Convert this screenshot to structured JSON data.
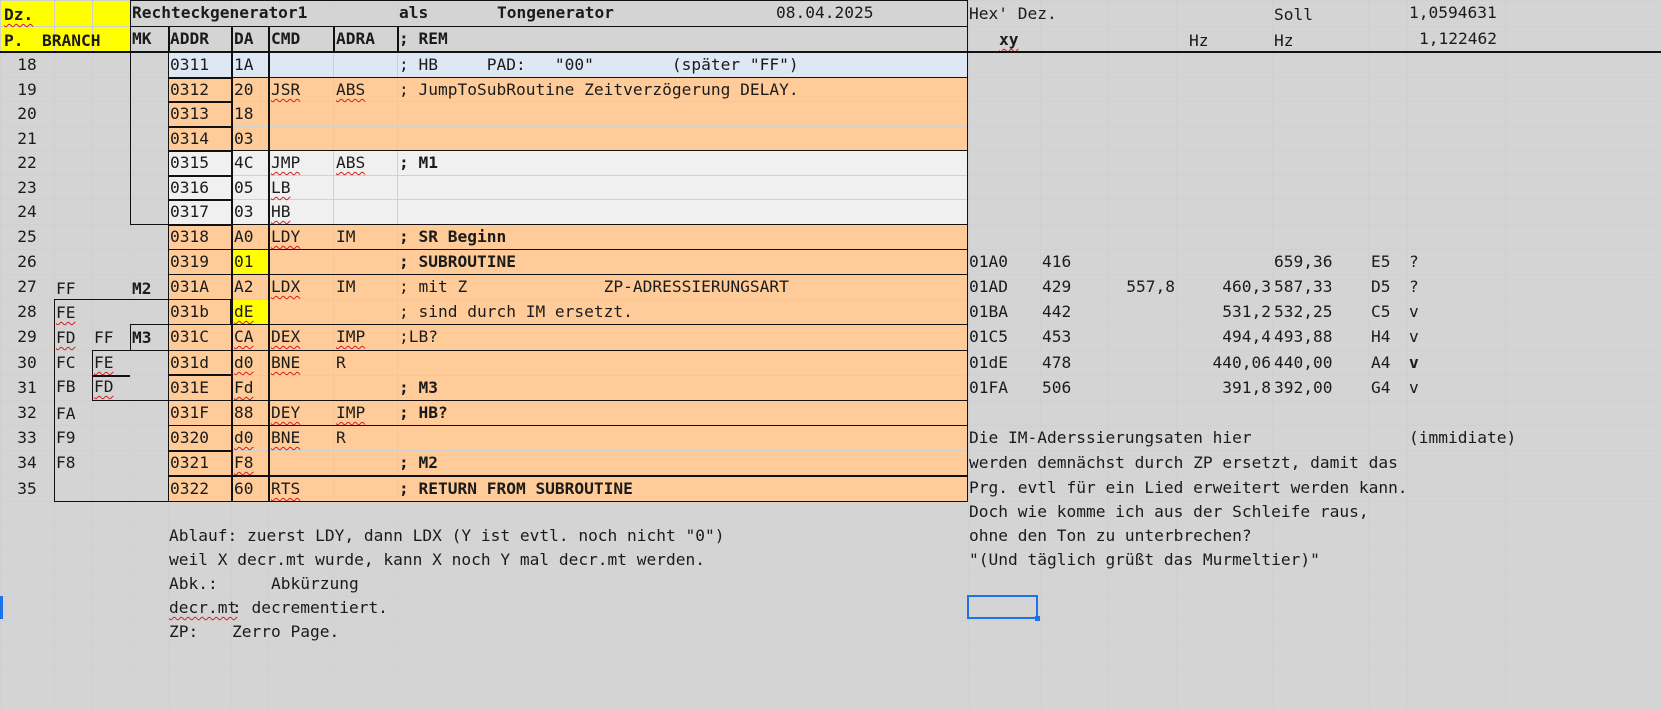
{
  "header": {
    "r1": {
      "dz": "Dz.",
      "title": "Rechteckgenerator1",
      "als": "als",
      "tongen": "Tongenerator",
      "date": "08.04.2025",
      "hexdez": "Hex' Dez.",
      "soll": "Soll",
      "factor1": "1,0594631"
    },
    "r2": {
      "p": "P.",
      "branch": "BRANCH",
      "mk": "MK",
      "addr": "ADDR",
      "da": "DA",
      "cmd": "CMD",
      "adra": "ADRA",
      "rem": "; REM",
      "xy": "xy",
      "hz1": "Hz",
      "hz2": "Hz",
      "factor2": "1,122462"
    }
  },
  "rows": [
    {
      "n": "18",
      "addr": "0311",
      "da": "1A",
      "cmd": "",
      "adra": "",
      "rem": "; HB     PAD:   \"00\"        (später \"FF\")"
    },
    {
      "n": "19",
      "addr": "0312",
      "da": "20",
      "cmd": "JSR",
      "adra": "ABS",
      "rem": "; JumpToSubRoutine Zeitverzögerung DELAY."
    },
    {
      "n": "20",
      "addr": "0313",
      "da": "18",
      "cmd": "",
      "adra": "",
      "rem": ""
    },
    {
      "n": "21",
      "addr": "0314",
      "da": "03",
      "cmd": "",
      "adra": "",
      "rem": ""
    },
    {
      "n": "22",
      "addr": "0315",
      "da": "4C",
      "cmd": "JMP",
      "adra": "ABS",
      "rem": "; M1"
    },
    {
      "n": "23",
      "addr": "0316",
      "da": "05",
      "cmd": "LB",
      "adra": "",
      "rem": ""
    },
    {
      "n": "24",
      "addr": "0317",
      "da": "03",
      "cmd": "HB",
      "adra": "",
      "rem": ""
    },
    {
      "n": "25",
      "addr": "0318",
      "da": "A0",
      "cmd": "LDY",
      "adra": "IM",
      "rem": "; SR Beginn"
    },
    {
      "n": "26",
      "addr": "0319",
      "da": "01",
      "cmd": "",
      "adra": "",
      "rem": "; SUBROUTINE"
    },
    {
      "n": "27",
      "addr": "031A",
      "da": "A2",
      "cmd": "LDX",
      "adra": "IM",
      "rem": "; mit Z              ZP-ADRESSIERUNGSART"
    },
    {
      "n": "28",
      "addr": "031b",
      "da": "dE",
      "cmd": "",
      "adra": "",
      "rem": "; sind durch IM ersetzt."
    },
    {
      "n": "29",
      "addr": "031C",
      "da": "CA",
      "cmd": "DEX",
      "adra": "IMP",
      "rem": ";LB?"
    },
    {
      "n": "30",
      "addr": "031d",
      "da": "d0",
      "cmd": "BNE",
      "adra": "R",
      "rem": ""
    },
    {
      "n": "31",
      "addr": "031E",
      "da": "Fd",
      "cmd": "",
      "adra": "",
      "rem": "; M3"
    },
    {
      "n": "32",
      "addr": "031F",
      "da": "88",
      "cmd": "DEY",
      "adra": "IMP",
      "rem": "; HB?"
    },
    {
      "n": "33",
      "addr": "0320",
      "da": "d0",
      "cmd": "BNE",
      "adra": "R",
      "rem": ""
    },
    {
      "n": "34",
      "addr": "0321",
      "da": "F8",
      "cmd": "",
      "adra": "",
      "rem": "; M2"
    },
    {
      "n": "35",
      "addr": "0322",
      "da": "60",
      "cmd": "RTS",
      "adra": "",
      "rem": "; RETURN FROM SUBROUTINE"
    }
  ],
  "branch": {
    "r27": {
      "a": "FF",
      "m": "M2"
    },
    "r28": {
      "a": "FE"
    },
    "r29": {
      "a": "FD",
      "b": "FF",
      "m": "M3"
    },
    "r30": {
      "a": "FC",
      "b": "FE"
    },
    "r31": {
      "a": "FB",
      "b": "FD"
    },
    "r32": {
      "a": "FA"
    },
    "r33": {
      "a": "F9"
    },
    "r34": {
      "a": "F8"
    }
  },
  "freq": [
    {
      "hex": "01A0",
      "dez": "416",
      "x": "",
      "hz": "",
      "soll": "659,36",
      "note": "E5",
      "mark": "?"
    },
    {
      "hex": "01AD",
      "dez": "429",
      "x": "557,8",
      "hz": "460,3",
      "soll": "587,33",
      "note": "D5",
      "mark": "?"
    },
    {
      "hex": "01BA",
      "dez": "442",
      "x": "",
      "hz": "531,2",
      "soll": "532,25",
      "note": "C5",
      "mark": "v"
    },
    {
      "hex": "01C5",
      "dez": "453",
      "x": "",
      "hz": "494,4",
      "soll": "493,88",
      "note": "H4",
      "mark": "v"
    },
    {
      "hex": "01dE",
      "dez": "478",
      "x": "",
      "hz": "440,06",
      "soll": "440,00",
      "note": "A4",
      "mark": "v"
    },
    {
      "hex": "01FA",
      "dez": "506",
      "x": "",
      "hz": "391,8",
      "soll": "392,00",
      "note": "G4",
      "mark": "v"
    }
  ],
  "notes_right": {
    "l1": "Die IM-Aderssierungsaten hier",
    "l1b": "(immidiate)",
    "l2": "werden demnächst durch ZP ersetzt, damit das",
    "l3": "Prg. evtl für ein Lied erweitert werden kann.",
    "l4": "Doch wie komme ich aus der Schleife raus,",
    "l5": "ohne den Ton zu unterbrechen?",
    "l6": "\"(Und täglich grüßt das Murmeltier)\""
  },
  "notes_bottom": {
    "l1": "Ablauf: zuerst LDY, dann LDX (Y ist evtl. noch nicht \"0\")",
    "l2": "weil X decr.mt wurde, kann X noch Y mal decr.mt werden.",
    "l3a": "Abk.:",
    "l3b": "Abkürzung",
    "l4a": "decr.mt",
    "l4b": ": decrementiert.",
    "l5a": "ZP:",
    "l5b": "Zerro Page."
  },
  "colors": {
    "yellow": "#ffff00",
    "orange": "#ffcc99",
    "blue": "#dde8f4",
    "gray": "#f0f0f0",
    "selection": "#1a73e8"
  }
}
